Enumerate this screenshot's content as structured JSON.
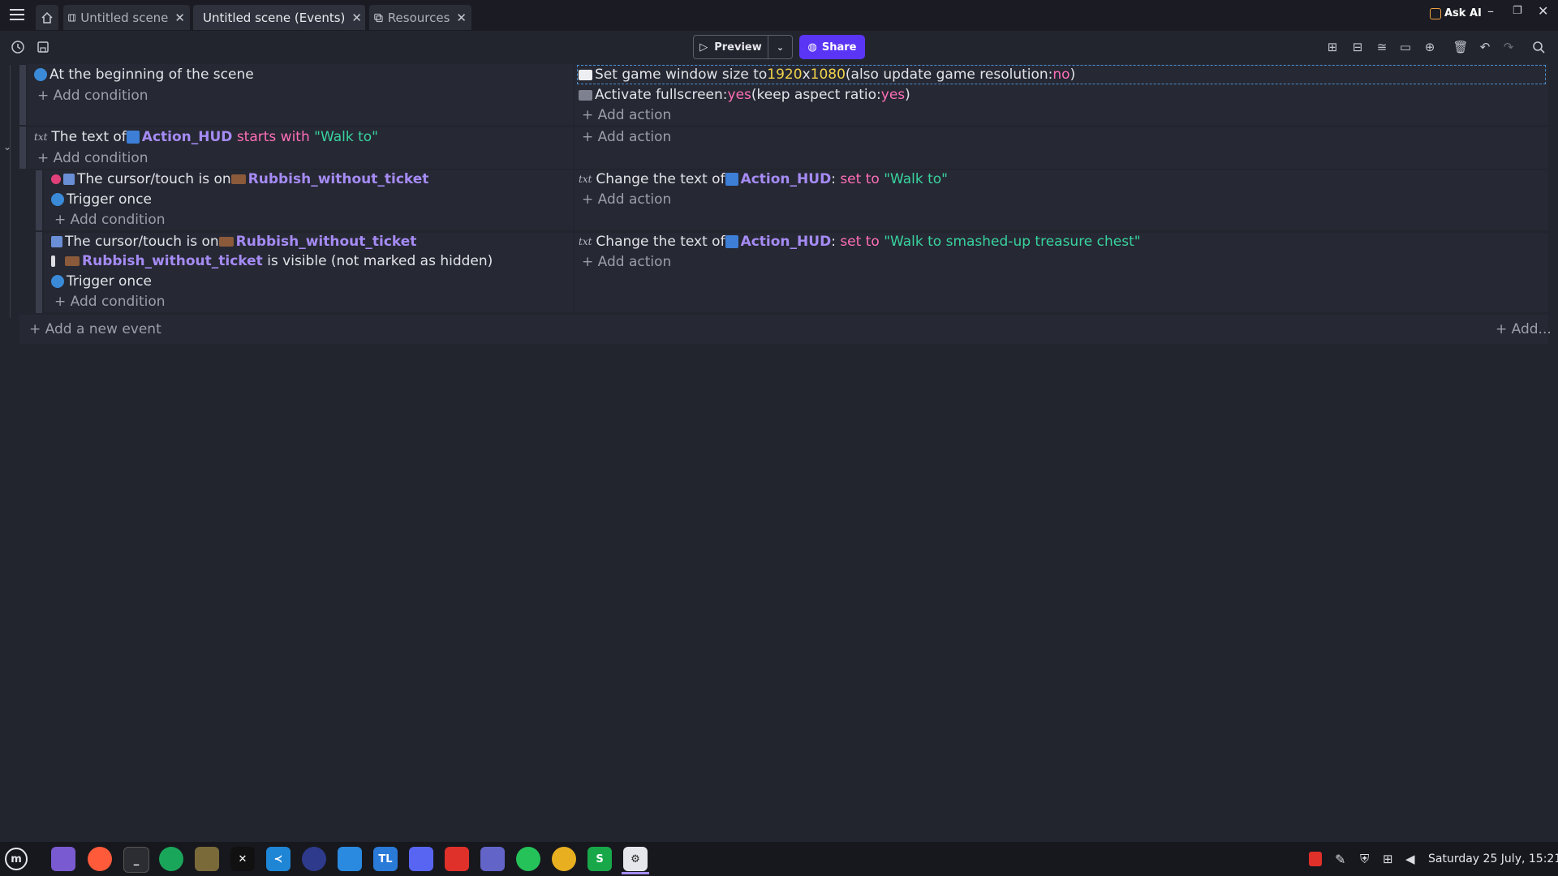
{
  "tabs": [
    {
      "label": "Untitled scene",
      "icon": "film-icon"
    },
    {
      "label": "Untitled scene (Events)",
      "icon": "events-icon"
    },
    {
      "label": "Resources",
      "icon": "resources-icon"
    }
  ],
  "ask_ai": "Ask AI",
  "toolbar": {
    "preview": "Preview",
    "share": "Share"
  },
  "events": {
    "e1": {
      "cond1": "At the beginning of the scene",
      "add_condition": "+ Add condition",
      "act1_pre": "Set game window size to ",
      "act1_w": "1920",
      "act1_x": "x",
      "act1_h": "1080",
      "act1_mid": " (also update game resolution: ",
      "act1_no": "no",
      "act1_end": ")",
      "act2_pre": "Activate fullscreen: ",
      "act2_yes": "yes",
      "act2_mid": " (keep aspect ratio: ",
      "act2_yes2": "yes",
      "act2_end": ")",
      "add_action": "+ Add action"
    },
    "e2": {
      "cond_pre": "The text of ",
      "cond_obj": "Action_HUD",
      "cond_kw": " starts with ",
      "cond_str": "\"Walk to\"",
      "add_condition": "+ Add condition",
      "add_action": "+ Add action"
    },
    "s1": {
      "cond1_pre": "The cursor/touch is on ",
      "cond1_obj": "Rubbish_without_ticket",
      "cond2": "Trigger once",
      "add_condition": "+ Add condition",
      "act_pre": "Change the text of ",
      "act_obj": "Action_HUD",
      "act_colon": ": ",
      "act_kw": "set to ",
      "act_str": "\"Walk to\"",
      "add_action": "+ Add action"
    },
    "s2": {
      "cond1_pre": "The cursor/touch is on ",
      "cond1_obj": "Rubbish_without_ticket",
      "cond2_obj": "Rubbish_without_ticket",
      "cond2_post": " is visible (not marked as hidden)",
      "cond3": "Trigger once",
      "add_condition": "+ Add condition",
      "act_pre": "Change the text of ",
      "act_obj": "Action_HUD",
      "act_colon": ": ",
      "act_kw": "set to ",
      "act_str": "\"Walk to smashed-up treasure chest\"",
      "add_action": "+ Add action"
    }
  },
  "add_new_event": "+ Add a new event",
  "add_menu": "+ Add...",
  "taskbar": {
    "apps": [
      "files-icon",
      "firefox-icon",
      "terminal-icon",
      "vpn-icon",
      "minecraft-icon",
      "capcut-icon",
      "vscode-icon",
      "gdevelop-icon",
      "notes-icon",
      "tl-icon",
      "discord-icon",
      "brave-icon",
      "teams-icon",
      "whatsapp-icon",
      "chrome-icon",
      "s-icon",
      "settings-icon"
    ],
    "tl_label": "TL",
    "s_label": "S",
    "clock": "Saturday 25 July, 15:21"
  },
  "colors": {
    "accent": "#5b35f5",
    "object": "#a58bf4",
    "keyword": "#ff6fb8",
    "string": "#38d39f",
    "number": "#f2d24b"
  }
}
